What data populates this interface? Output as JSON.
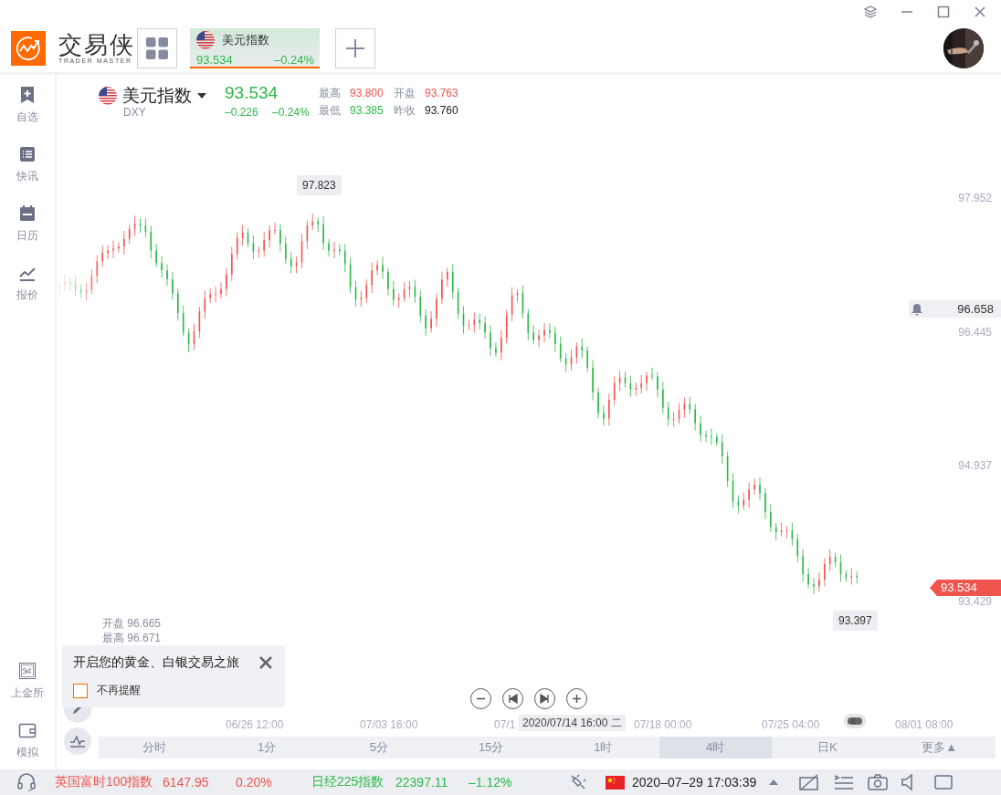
{
  "app": {
    "name": "交易侠",
    "subtitle": "TRADER MASTER"
  },
  "open_tabs": [
    {
      "name": "美元指数",
      "price": "93.534",
      "change": "–0.24%",
      "selected": true
    }
  ],
  "sidebar": {
    "items": [
      {
        "label": "自选",
        "kind": "watchlist"
      },
      {
        "label": "快讯",
        "kind": "news"
      },
      {
        "label": "日历",
        "kind": "calendar"
      },
      {
        "label": "报价",
        "kind": "quotes"
      }
    ],
    "bottom_items": [
      {
        "label": "上金所",
        "kind": "sge"
      },
      {
        "label": "模拟",
        "kind": "wallet"
      }
    ]
  },
  "quote": {
    "name": "美元指数",
    "code": "DXY",
    "price": "93.534",
    "change": "–0.226",
    "change_pct": "–0.24%",
    "stats": [
      {
        "label": "最高",
        "value": "93.800",
        "color": "#f0544f"
      },
      {
        "label": "开盘",
        "value": "93.763",
        "color": "#f0544f"
      },
      {
        "label": "最低",
        "value": "93.385",
        "color": "#2db84a"
      },
      {
        "label": "昨收",
        "value": "93.760",
        "color": "#222222"
      }
    ]
  },
  "chart": {
    "price_labels": [
      "97.952",
      "96.445",
      "94.937",
      "93.429"
    ],
    "time_labels": [
      "06/26 12:00",
      "07/03 16:00",
      "07/1",
      "07/18 00:00",
      "07/25 04:00",
      "08/01 08:00"
    ],
    "high_marker": "97.823",
    "low_marker": "93.397",
    "alert_price": "96.658",
    "last_price": "93.534",
    "crosshair_time": "2020/07/14 16:00 二",
    "ohlc": [
      {
        "label": "开盘",
        "value": "96.665"
      },
      {
        "label": "最高",
        "value": "96.671"
      }
    ]
  },
  "popup": {
    "message": "开启您的黄金、白银交易之旅",
    "checkbox": {
      "label": "不再提醒",
      "checked": false
    }
  },
  "periods": [
    {
      "label": "分时",
      "selected": false
    },
    {
      "label": "1分",
      "selected": false
    },
    {
      "label": "5分",
      "selected": false
    },
    {
      "label": "15分",
      "selected": false
    },
    {
      "label": "1时",
      "selected": false
    },
    {
      "label": "4时",
      "selected": true
    },
    {
      "label": "日K",
      "selected": false
    },
    {
      "label": "更多▲",
      "selected": false
    }
  ],
  "status_bar": {
    "tickers": [
      {
        "name": "英国富时100指数",
        "value": "6147.95",
        "change": "0.20%",
        "color": "#f0544f"
      },
      {
        "name": "日经225指数",
        "value": "22397.11",
        "change": "–1.12%",
        "color": "#2db84a"
      }
    ],
    "datetime": "2020–07–29 17:03:39"
  }
}
